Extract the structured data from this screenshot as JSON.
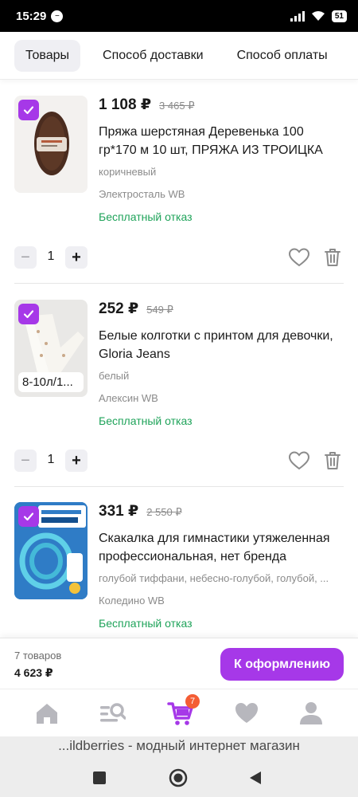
{
  "status_bar": {
    "time": "15:29",
    "battery": "51"
  },
  "tabs": [
    {
      "label": "Товары",
      "active": true
    },
    {
      "label": "Способ доставки",
      "active": false
    },
    {
      "label": "Способ оплаты",
      "active": false
    }
  ],
  "products": [
    {
      "price": "1 108 ₽",
      "old_price": "3 465 ₽",
      "title": "Пряжа шерстяная Деревенька 100 гр*170 м 10 шт, ПРЯЖА ИЗ ТРОИЦКА",
      "color": "коричневый",
      "warehouse": "Электросталь WB",
      "free_return": "Бесплатный отказ",
      "quantity": "1",
      "size": "",
      "selected": true
    },
    {
      "price": "252 ₽",
      "old_price": "549 ₽",
      "title": "Белые колготки с принтом для девочки, Gloria Jeans",
      "color": "белый",
      "warehouse": "Алексин WB",
      "free_return": "Бесплатный отказ",
      "quantity": "1",
      "size": "8-10л/1...",
      "selected": true
    },
    {
      "price": "331 ₽",
      "old_price": "2 550 ₽",
      "title": "Скакалка для гимнастики утяжеленная профессиональная, нет бренда",
      "color": "голубой тиффани, небесно-голубой, голубой, ...",
      "warehouse": "Коледино WB",
      "free_return": "Бесплатный отказ",
      "quantity": "1",
      "size": "",
      "selected": true
    }
  ],
  "summary": {
    "count": "7 товаров",
    "total": "4 623 ₽",
    "checkout_label": "К оформлению"
  },
  "bottom_nav": {
    "items": [
      {
        "icon": "home-icon"
      },
      {
        "icon": "catalog-search-icon"
      },
      {
        "icon": "cart-icon",
        "active": true,
        "badge": "7"
      },
      {
        "icon": "favorites-heart-icon"
      },
      {
        "icon": "profile-icon"
      }
    ]
  },
  "browser": {
    "title": "...ildberries - модный интернет магазин"
  },
  "colors": {
    "accent": "#a638e8",
    "free_return": "#1fa35a",
    "badge": "#f45d35"
  }
}
